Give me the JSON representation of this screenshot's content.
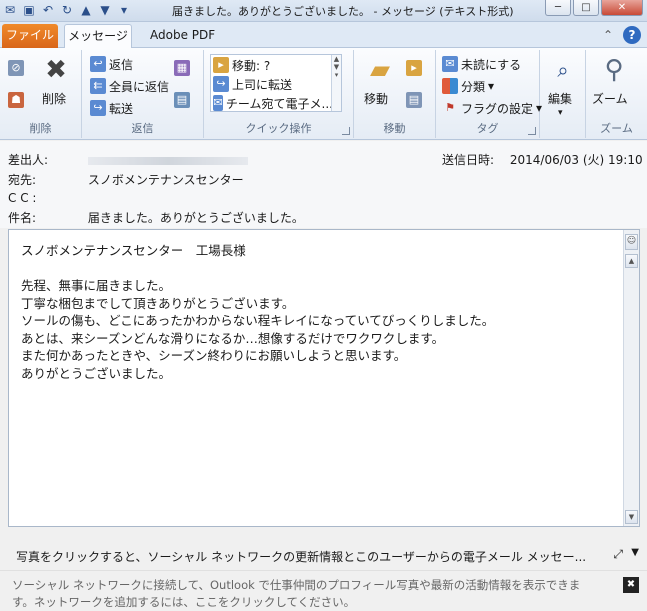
{
  "window": {
    "title": "届きました。ありがとうございました。 - メッセージ (テキスト形式)",
    "minimize": "─",
    "maximize": "□",
    "close": "✕"
  },
  "tabs": [
    {
      "label": "ファイル"
    },
    {
      "label": "メッセージ"
    },
    {
      "label": "Adobe PDF"
    }
  ],
  "ribbon": {
    "delete_group": {
      "label": "削除",
      "delete_button": "削除"
    },
    "reply_group": {
      "label": "返信",
      "reply": "返信",
      "reply_all": "全員に返信",
      "forward": "転送"
    },
    "quick_group": {
      "label": "クイック操作",
      "items": [
        "移動: ?",
        "上司に転送",
        "チーム宛て電子メ..."
      ]
    },
    "move_group": {
      "label": "移動",
      "move_button": "移動"
    },
    "tags_group": {
      "label": "タグ",
      "unread": "未読にする",
      "categorize": "分類",
      "followup": "フラグの設定"
    },
    "edit_group": {
      "label": "",
      "edit_button": "編集"
    },
    "zoom_group": {
      "label": "ズーム",
      "zoom_button": "ズーム"
    }
  },
  "header": {
    "from_label": "差出人:",
    "sent_label": "送信日時:",
    "sent_value": "2014/06/03 (火) 19:10",
    "to_label": "宛先:",
    "to_value": "スノボメンテナンスセンター",
    "cc_label": "C C :",
    "subject_label": "件名:",
    "subject_value": "届きました。ありがとうございました。"
  },
  "body": {
    "lines": [
      "スノボメンテナンスセンター　工場長様",
      "",
      "先程、無事に届きました。",
      "丁寧な梱包までして頂きありがとうございます。",
      "ソールの傷も、どこにあったかわからない程キレイになっていてびっくりしました。",
      "あとは、来シーズンどんな滑りになるか…想像するだけでワクワクします。",
      "また何かあったときや、シーズン終わりにお願いしようと思います。",
      "ありがとうございました。"
    ]
  },
  "social": {
    "bar_text": "写真をクリックすると、ソーシャル ネットワークの更新情報とこのユーザーからの電子メール メッセー...",
    "connect_line1": "ソーシャル ネットワークに接続して、Outlook で仕事仲間のプロフィール写真や最新の活動情報を表示できま",
    "connect_line2": "す。ネットワークを追加するには、ここをクリックしてください。"
  },
  "colors": {
    "file_tab": "#e8771f",
    "accent": "#2f6ac0"
  }
}
